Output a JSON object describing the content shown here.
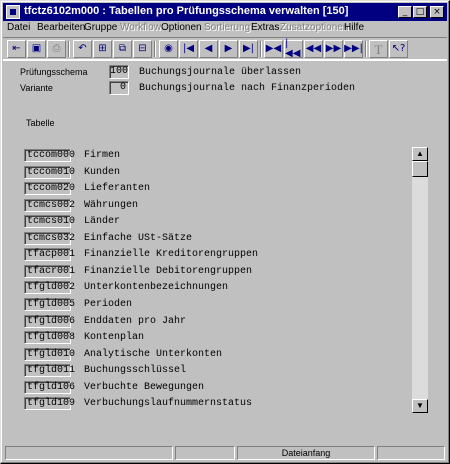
{
  "window": {
    "title": "tfctz6102m000 : Tabellen pro Prüfungsschema verwalten [150]",
    "min": "_",
    "max": "□",
    "close": "×"
  },
  "menu": [
    {
      "label": "Datei",
      "enabled": true
    },
    {
      "label": "Bearbeiten",
      "enabled": true
    },
    {
      "label": "Gruppe",
      "enabled": true
    },
    {
      "label": "Workflow",
      "enabled": false
    },
    {
      "label": "Optionen",
      "enabled": true
    },
    {
      "label": "Sortierung",
      "enabled": false
    },
    {
      "label": "Extras",
      "enabled": true
    },
    {
      "label": "Zusatzoptionen",
      "enabled": false
    },
    {
      "label": "Hilfe",
      "enabled": true
    }
  ],
  "toolbar_icons": [
    "exit-icon",
    "save-icon",
    "print-icon",
    "undo-icon",
    "tree-icon",
    "copy-icon",
    "tree-icon",
    "find-icon",
    "first-icon",
    "previous-icon",
    "next-icon",
    "last-icon",
    "first-group-icon",
    "previous-group-icon",
    "previous-page-icon",
    "next-page-icon",
    "next-group-icon",
    "last-group-icon",
    "text-icon",
    "help-icon"
  ],
  "form": {
    "schema_label": "Prüfungsschema",
    "schema_value": "100",
    "schema_desc": "Buchungsjournale überlassen",
    "variant_label": "Variante",
    "variant_value": "0",
    "variant_desc": "Buchungsjournale nach Finanzperioden",
    "table_header": "Tabelle"
  },
  "rows": [
    {
      "code": "tccom000",
      "desc": "Firmen"
    },
    {
      "code": "tccom010",
      "desc": "Kunden"
    },
    {
      "code": "tccom020",
      "desc": "Lieferanten"
    },
    {
      "code": "tcmcs002",
      "desc": "Währungen"
    },
    {
      "code": "tcmcs010",
      "desc": "Länder"
    },
    {
      "code": "tcmcs032",
      "desc": "Einfache USt-Sätze"
    },
    {
      "code": "tfacp001",
      "desc": "Finanzielle Kreditorengruppen"
    },
    {
      "code": "tfacr001",
      "desc": "Finanzielle Debitorengruppen"
    },
    {
      "code": "tfgld002",
      "desc": "Unterkontenbezeichnungen"
    },
    {
      "code": "tfgld005",
      "desc": "Perioden"
    },
    {
      "code": "tfgld006",
      "desc": "Enddaten pro Jahr"
    },
    {
      "code": "tfgld008",
      "desc": "Kontenplan"
    },
    {
      "code": "tfgld010",
      "desc": "Analytische Unterkonten"
    },
    {
      "code": "tfgld011",
      "desc": "Buchungsschlüssel"
    },
    {
      "code": "tfgld106",
      "desc": "Verbuchte Bewegungen"
    },
    {
      "code": "tfgld109",
      "desc": "Verbuchungslaufnummernstatus"
    }
  ],
  "status": {
    "panel3": "Dateianfang"
  }
}
